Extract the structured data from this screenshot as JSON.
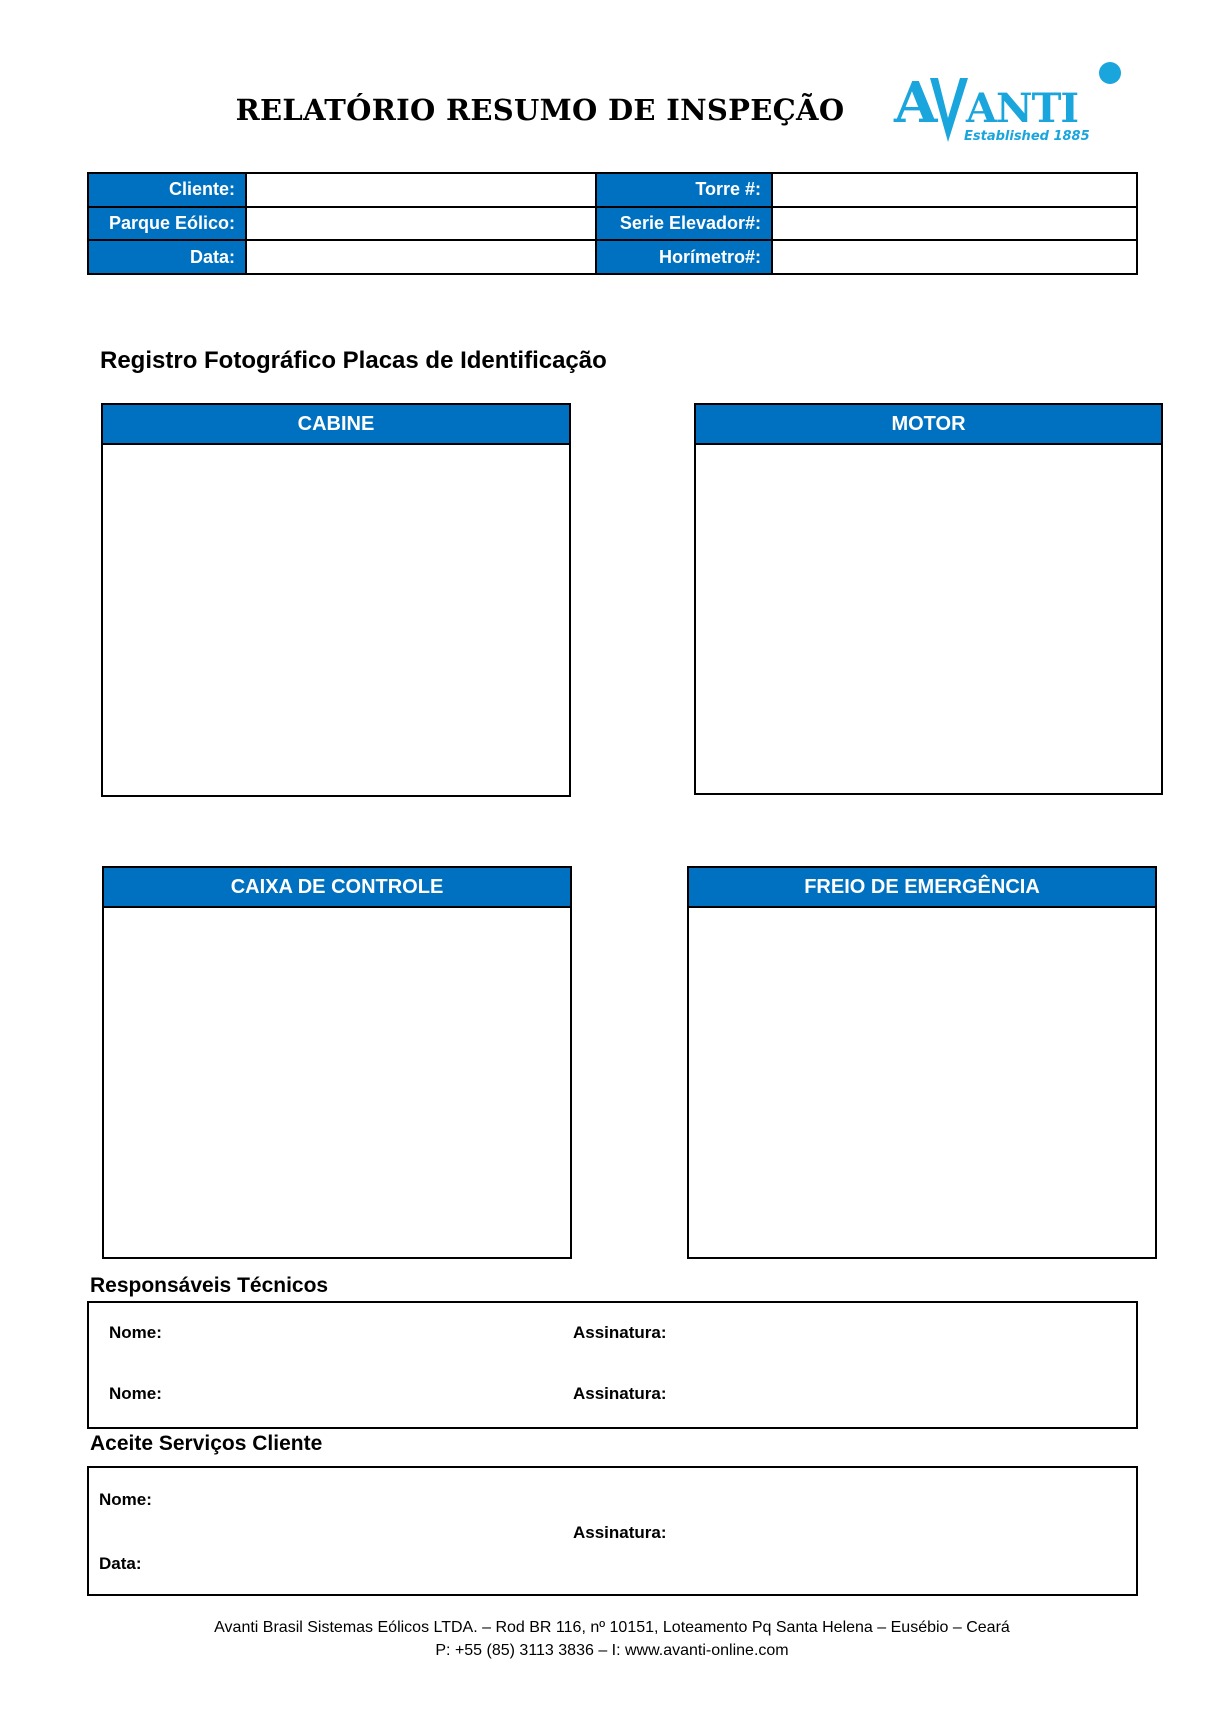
{
  "document": {
    "title": "RELATÓRIO RESUMO DE INSPEÇÃO"
  },
  "logo": {
    "brand": "AVANTI",
    "tagline": "Established 1885",
    "color": "#1aa5dc"
  },
  "info_table": {
    "rows": [
      {
        "left_label": "Cliente:",
        "left_value": "",
        "right_label": "Torre #:",
        "right_value": ""
      },
      {
        "left_label": "Parque Eólico:",
        "left_value": "",
        "right_label": "Serie Elevador#:",
        "right_value": ""
      },
      {
        "left_label": "Data:",
        "left_value": "",
        "right_label": "Horímetro#:",
        "right_value": ""
      }
    ]
  },
  "photos": {
    "section_title": "Registro Fotográfico Placas de Identificação",
    "boxes": [
      {
        "label": "CABINE"
      },
      {
        "label": "MOTOR"
      },
      {
        "label": "CAIXA DE CONTROLE"
      },
      {
        "label": "FREIO DE EMERGÊNCIA"
      }
    ]
  },
  "technicians": {
    "section_title": "Responsáveis Técnicos",
    "name_label": "Nome:",
    "signature_label": "Assinatura:"
  },
  "client_acceptance": {
    "section_title": "Aceite Serviços Cliente",
    "name_label": "Nome:",
    "date_label": "Data:",
    "signature_label": "Assinatura:"
  },
  "footer": {
    "line1": "Avanti Brasil Sistemas Eólicos LTDA. – Rod BR 116, nº 10151, Loteamento Pq Santa Helena – Eusébio – Ceará",
    "line2": "P: +55 (85) 3113 3836 – I: www.avanti-online.com"
  },
  "colors": {
    "header_blue": "#0070c0"
  }
}
